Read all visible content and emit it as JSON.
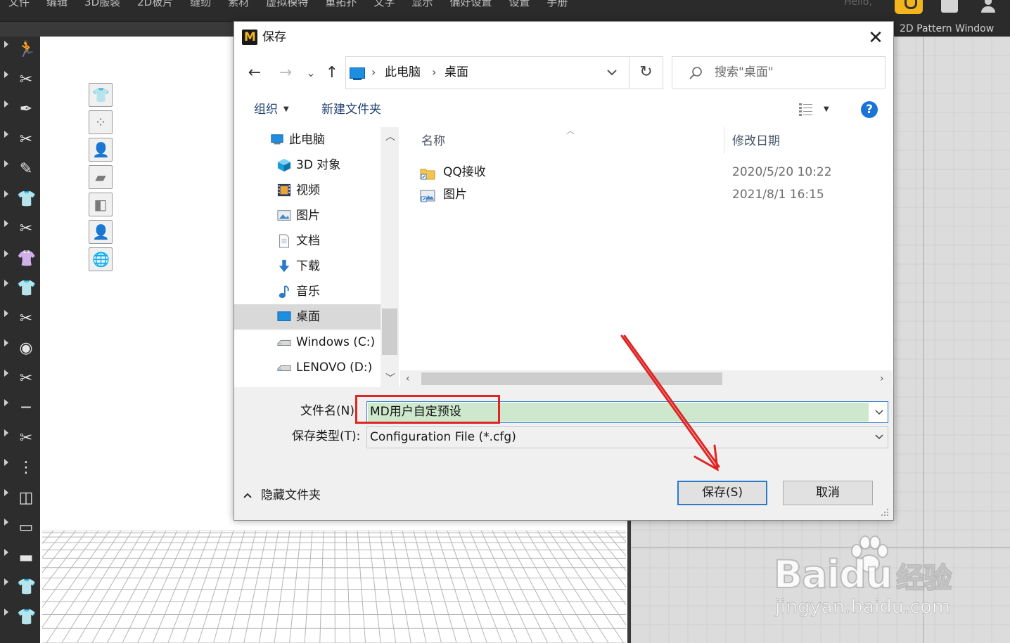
{
  "app": {
    "menu": [
      "文件",
      "编辑",
      "3D服装",
      "2D板片",
      "缝纫",
      "素材",
      "虚拟模特",
      "重拓扑",
      "文字",
      "显示",
      "偏好设置",
      "设置",
      "手册"
    ],
    "hello_text": "Hello,",
    "pattern_window_title": "2D Pattern Window",
    "left_tools": [
      "walk-icon",
      "tool-icon",
      "tool-icon",
      "tool-icon",
      "tool-icon",
      "fold-icon",
      "tool-icon",
      "garment-icon",
      "garment-icon",
      "tool-icon",
      "button-icon",
      "tool-icon",
      "line-icon",
      "tool-icon",
      "zipper-icon",
      "tool-icon",
      "tool-icon",
      "tool-icon",
      "garment-icon",
      "garment-icon"
    ],
    "view_icons": [
      "show-garment-icon",
      "show-points-icon",
      "show-avatar-icon",
      "show-texture-icon",
      "show-mesh-icon",
      "avatar-icon",
      "globe-icon"
    ]
  },
  "dialog": {
    "title": "保存",
    "logo_letter": "M",
    "close_glyph": "✕",
    "nav": {
      "back": "←",
      "forward": "→",
      "recent": "⌄",
      "up": "↑"
    },
    "address": {
      "root": "此电脑",
      "current": "桌面",
      "separator": "›"
    },
    "refresh_glyph": "↻",
    "search_placeholder": "搜索\"桌面\"",
    "toolbar": {
      "organize": "组织",
      "new_folder": "新建文件夹",
      "help": "?"
    },
    "tree": [
      {
        "label": "此电脑",
        "icon": "pc-icon",
        "selected": false
      },
      {
        "label": "3D 对象",
        "icon": "cube-icon",
        "selected": false
      },
      {
        "label": "视频",
        "icon": "video-icon",
        "selected": false
      },
      {
        "label": "图片",
        "icon": "pictures-icon",
        "selected": false
      },
      {
        "label": "文档",
        "icon": "document-icon",
        "selected": false
      },
      {
        "label": "下载",
        "icon": "download-icon",
        "selected": false
      },
      {
        "label": "音乐",
        "icon": "music-icon",
        "selected": false
      },
      {
        "label": "桌面",
        "icon": "desktop-icon",
        "selected": true
      },
      {
        "label": "Windows (C:)",
        "icon": "drive-icon",
        "selected": false
      },
      {
        "label": "LENOVO (D:)",
        "icon": "drive-icon",
        "selected": false
      }
    ],
    "columns": {
      "name": "名称",
      "date": "修改日期"
    },
    "files": [
      {
        "name": "QQ接收",
        "date": "2020/5/20 10:22",
        "icon": "folder-shortcut-icon"
      },
      {
        "name": "图片",
        "date": "2021/8/1 16:15",
        "icon": "picture-shortcut-icon"
      }
    ],
    "filename_label": "文件名(N):",
    "filename_value": "MD用户自定预设",
    "filetype_label": "保存类型(T):",
    "filetype_value": "Configuration File (*.cfg)",
    "hide_folders": "隐藏文件夹",
    "save_button": "保存(S)",
    "cancel_button": "取消"
  },
  "watermark": {
    "logo": "Baidu",
    "logo_cn": "经验",
    "url": "jingyan.baidu.com"
  },
  "colors": {
    "accent": "#2f79c9",
    "highlight": "#e02424",
    "selection": "#cde8cd",
    "brand": "#f2b51c"
  }
}
